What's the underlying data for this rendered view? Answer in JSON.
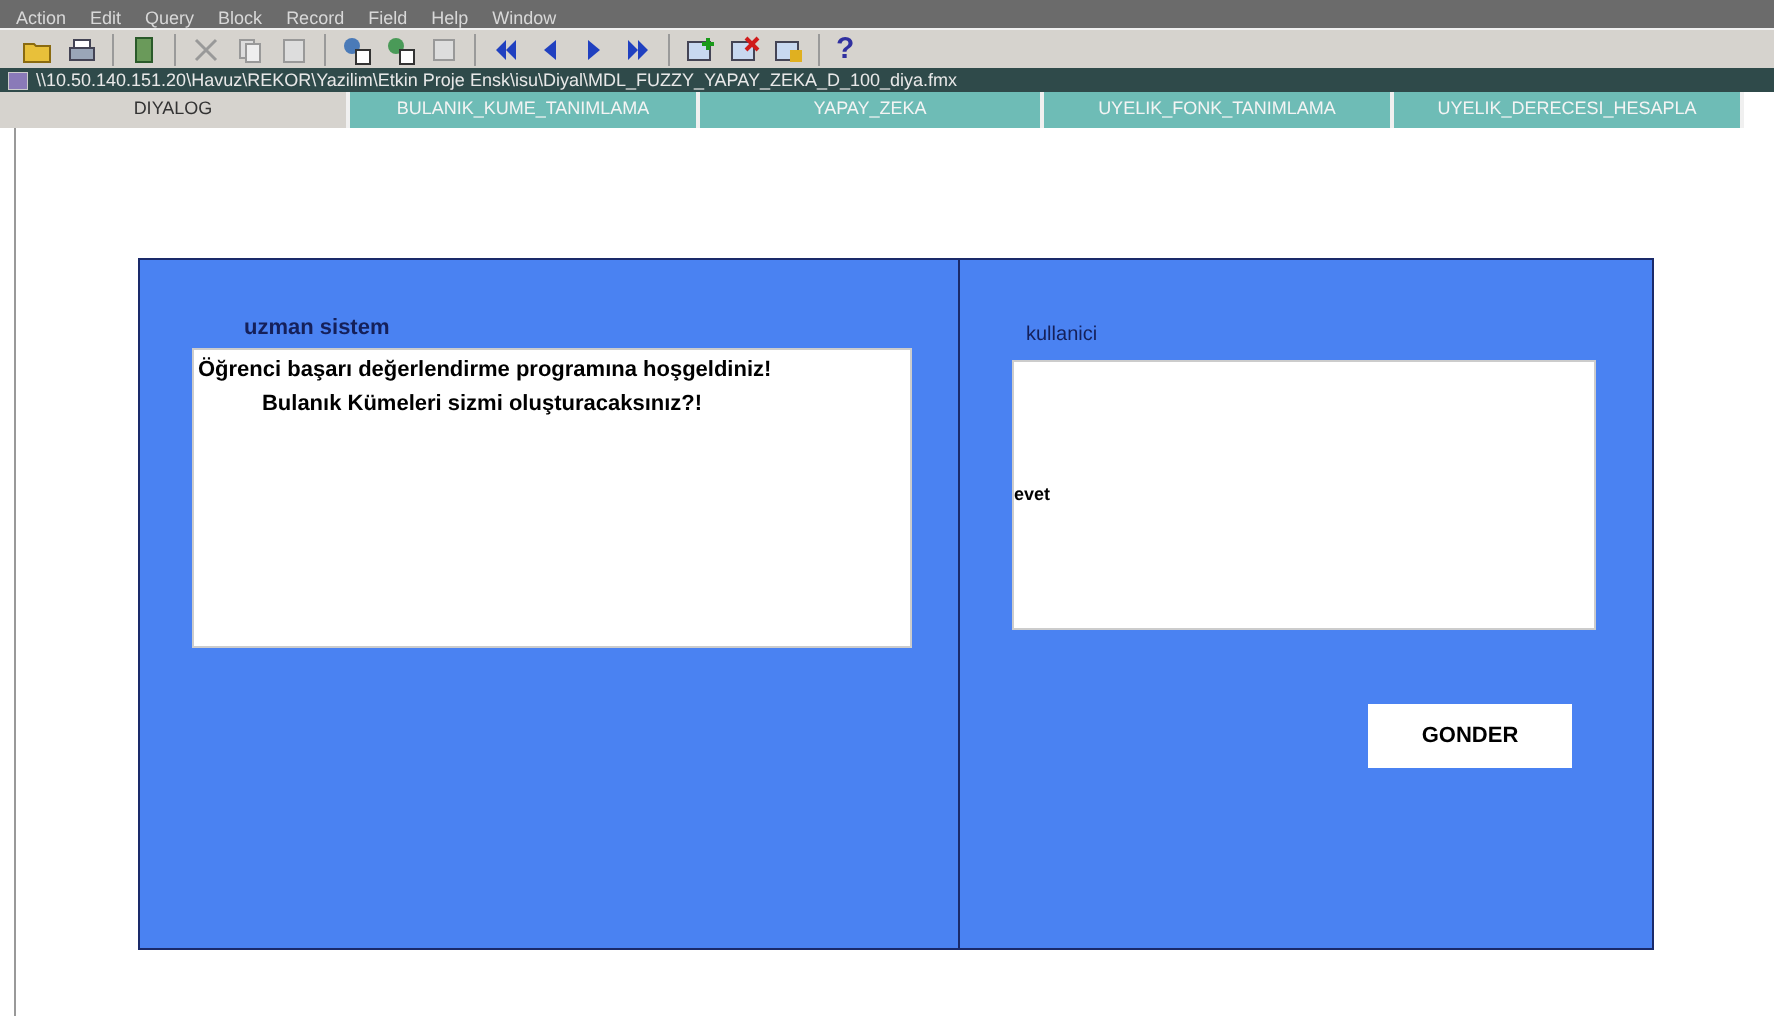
{
  "menu_bar": [
    "Action",
    "Edit",
    "Query",
    "Block",
    "Record",
    "Field",
    "Help",
    "Window"
  ],
  "toolbar": {
    "help": "?"
  },
  "path_bar": {
    "title": "\\\\10.50.140.151.20\\Havuz\\REKOR\\Yazilim\\Etkin Proje Ensk\\isu\\Diyal\\MDL_FUZZY_YAPAY_ZEKA_D_100_diya.fmx"
  },
  "tabs": [
    {
      "label": "DIYALOG",
      "selected": true
    },
    {
      "label": "BULANIK_KUME_TANIMLAMA",
      "selected": false
    },
    {
      "label": "YAPAY_ZEKA",
      "selected": false
    },
    {
      "label": "UYELIK_FONK_TANIMLAMA",
      "selected": false
    },
    {
      "label": "UYELIK_DERECESI_HESAPLA",
      "selected": false
    }
  ],
  "expert_panel": {
    "label": "uzman sistem",
    "lines": [
      "Öğrenci başarı değerlendirme programına hoşgeldiniz!",
      "Bulanık Kümeleri sizmi oluşturacaksınız?!"
    ]
  },
  "user_panel": {
    "label": "kullanici",
    "value": "evet"
  },
  "send_button": "GONDER"
}
